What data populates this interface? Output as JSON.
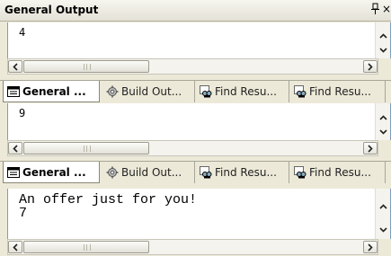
{
  "window": {
    "title": "General Output",
    "pin_icon": "pin-icon",
    "close_glyph": "×"
  },
  "panes": [
    {
      "lines": "4"
    },
    {
      "lines": "9"
    },
    {
      "lines": "An offer just for you!\n7"
    }
  ],
  "tab_strips": [
    {
      "tabs": [
        {
          "label": "General ...",
          "icon": "output-window-icon",
          "active": true
        },
        {
          "label": "Build Out...",
          "icon": "build-gear-icon",
          "active": false
        },
        {
          "label": "Find Resu...",
          "icon": "find-results-icon",
          "active": false
        },
        {
          "label": "Find Resu...",
          "icon": "find-results-icon",
          "active": false
        }
      ]
    },
    {
      "tabs": [
        {
          "label": "General ...",
          "icon": "output-window-icon",
          "active": true
        },
        {
          "label": "Build Out...",
          "icon": "build-gear-icon",
          "active": false
        },
        {
          "label": "Find Resu...",
          "icon": "find-results-icon",
          "active": false
        },
        {
          "label": "Find Resu...",
          "icon": "find-results-icon",
          "active": false
        }
      ]
    }
  ],
  "colors": {
    "chrome": "#ece9d8",
    "pane_border": "#7f9db9",
    "active_tab": "#ffffff"
  }
}
